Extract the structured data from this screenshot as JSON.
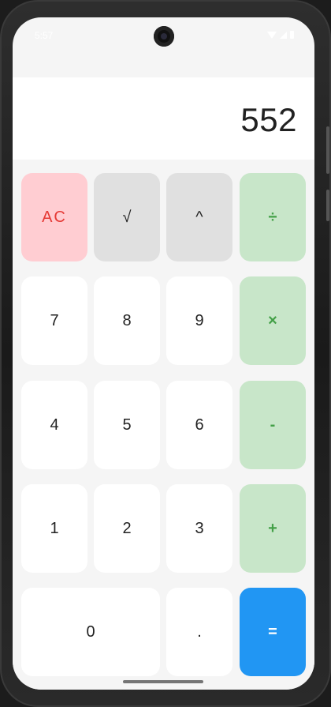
{
  "status_bar": {
    "time": "5:57",
    "icons": [
      "wifi-icon",
      "signal-icon",
      "battery-icon"
    ]
  },
  "display": {
    "value": "552"
  },
  "keys": {
    "ac": "AC",
    "sqrt": "√",
    "power": "^",
    "divide": "÷",
    "seven": "7",
    "eight": "8",
    "nine": "9",
    "multiply": "×",
    "four": "4",
    "five": "5",
    "six": "6",
    "subtract": "-",
    "one": "1",
    "two": "2",
    "three": "3",
    "add": "+",
    "zero": "0",
    "decimal": ".",
    "equals": "="
  },
  "colors": {
    "ac_bg": "#ffcdd2",
    "ac_text": "#e53935",
    "function_bg": "#e0e0e0",
    "operator_bg": "#c8e6c9",
    "operator_text": "#43a047",
    "equals_bg": "#2196f3",
    "number_bg": "#ffffff"
  }
}
